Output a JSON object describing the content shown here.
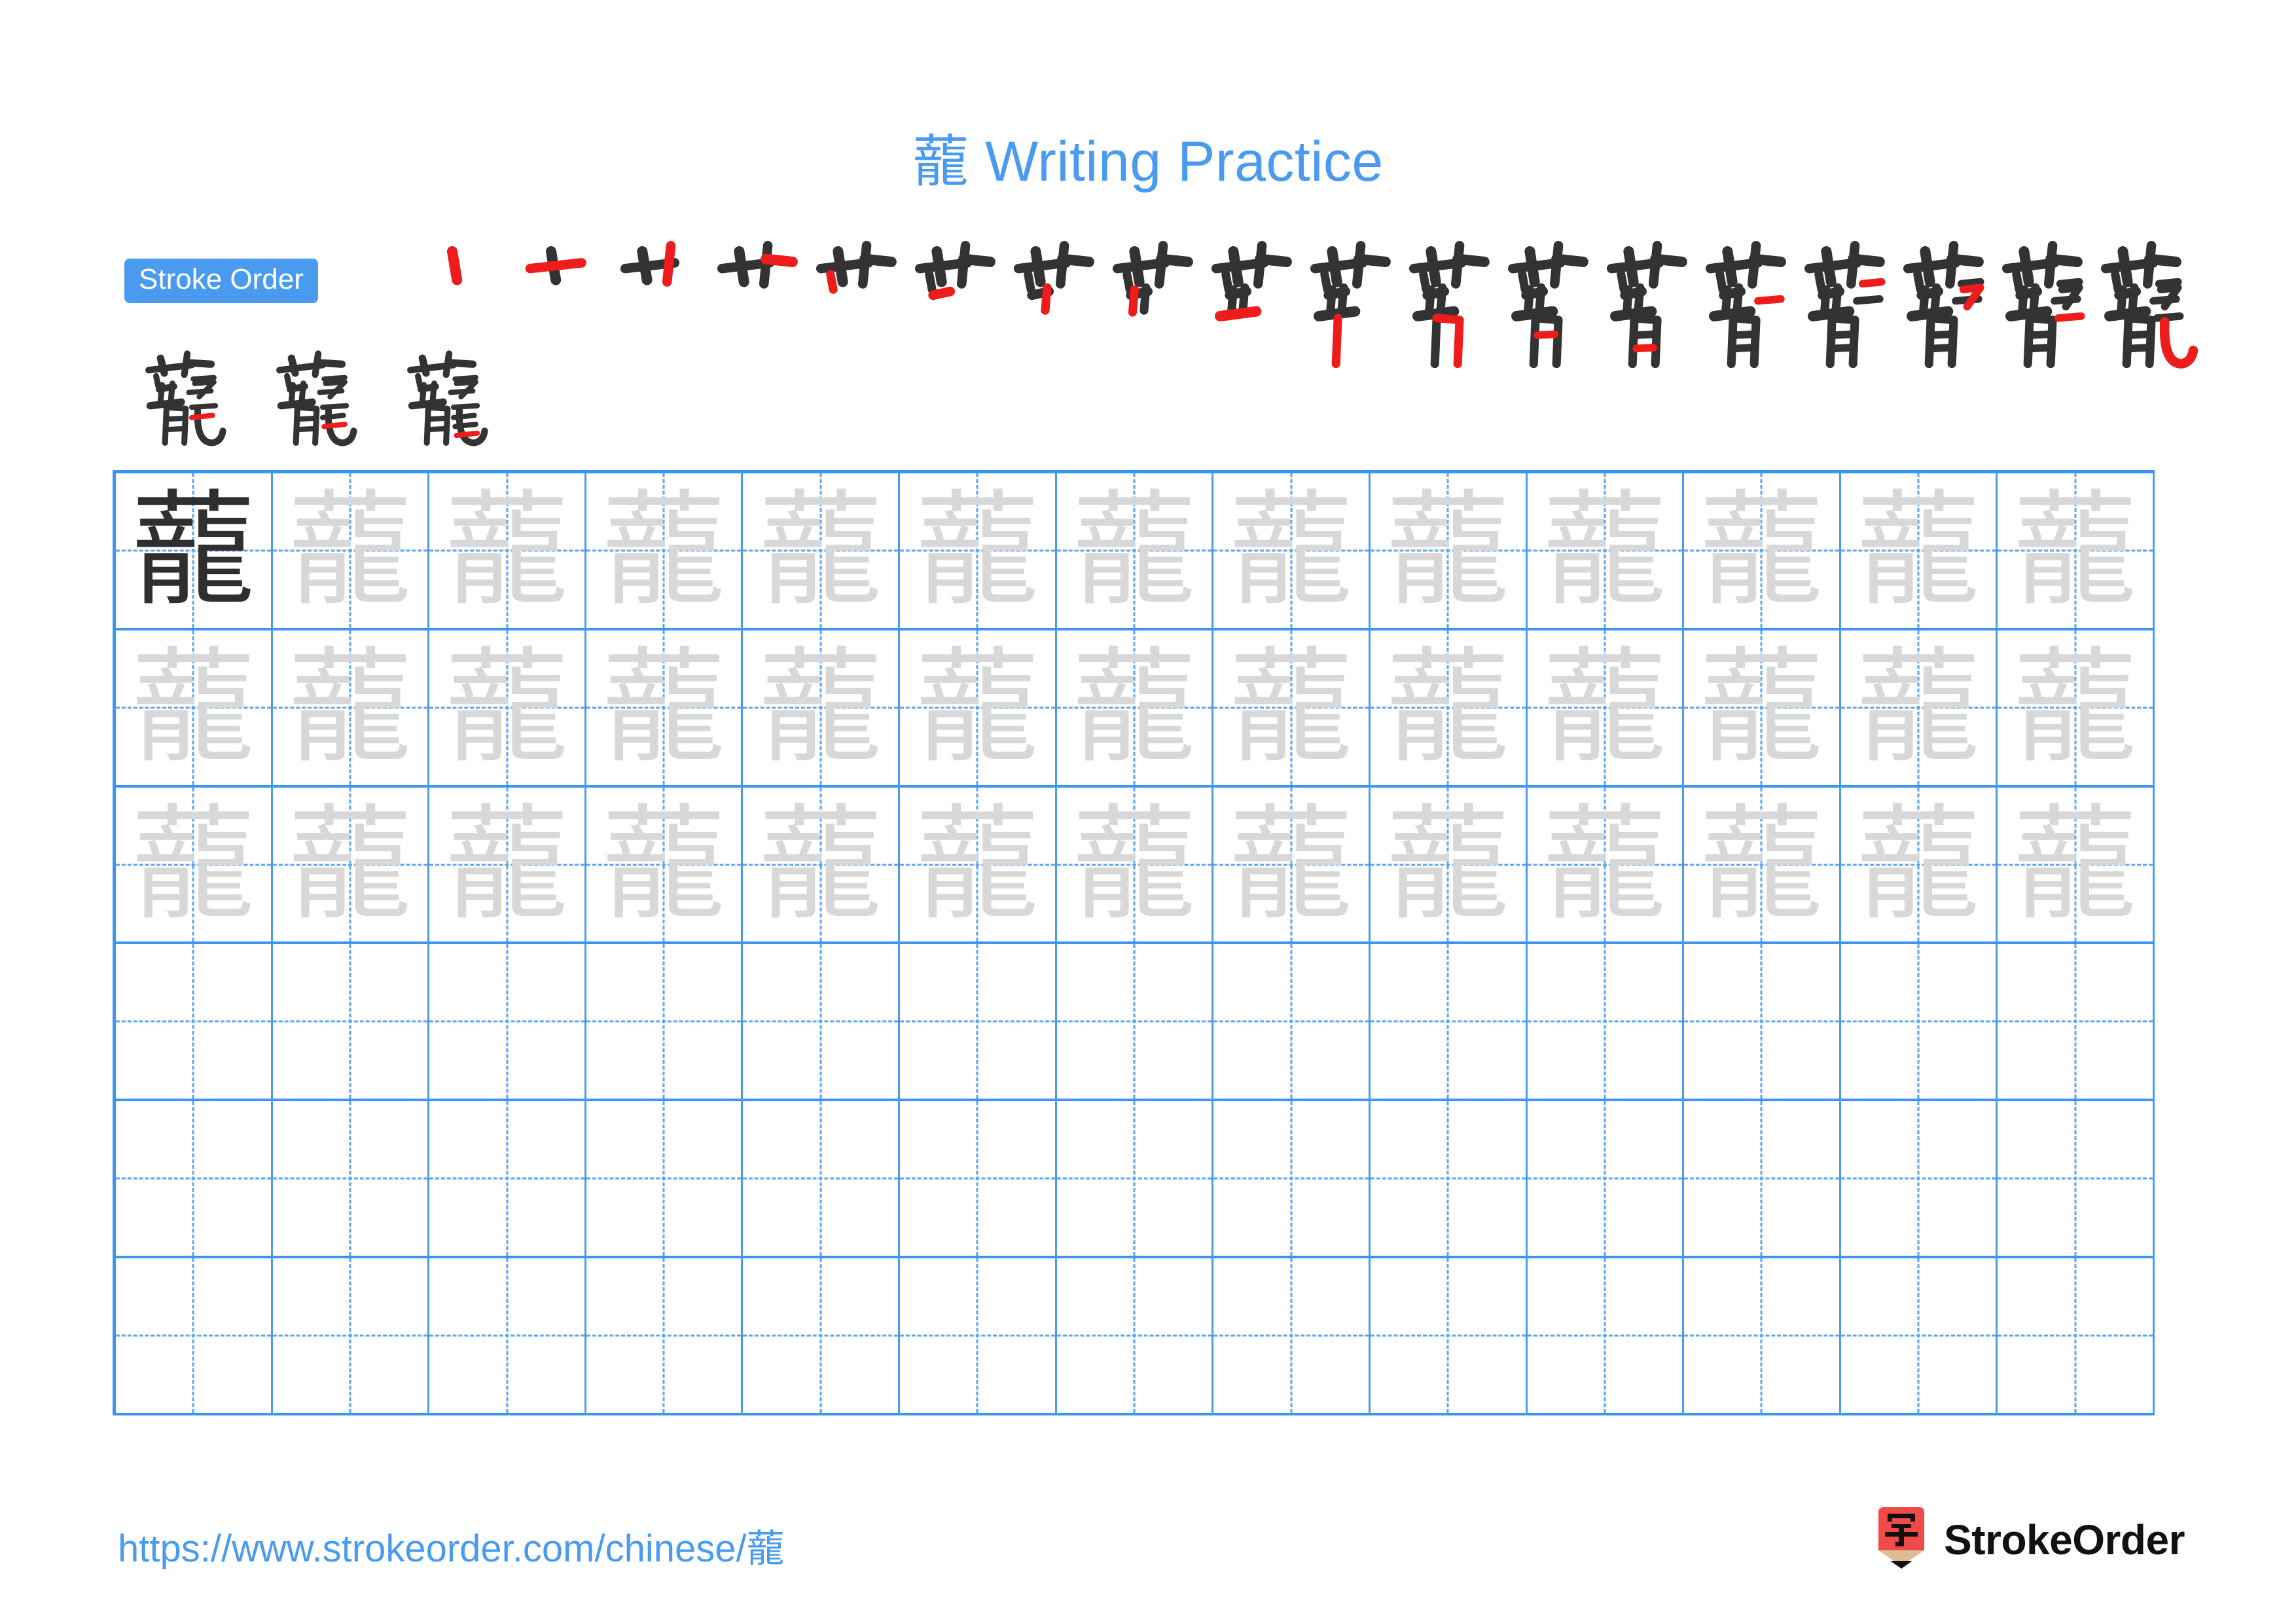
{
  "page": {
    "character": "蘢",
    "title_text": "蘢 Writing Practice",
    "title_color": "#4a9bf0",
    "background": "#ffffff"
  },
  "stroke_order": {
    "badge_label": "Stroke Order",
    "badge_bg": "#4a9bf0",
    "badge_text_color": "#ffffff",
    "total_strokes": 21,
    "new_stroke_color": "#ee1c1c",
    "prior_stroke_color": "#333333",
    "row1_count": 18,
    "row2_count": 3,
    "steps": [
      {
        "index": 1,
        "glyph": "丶",
        "new_stroke": "dot"
      },
      {
        "index": 2,
        "glyph": "一",
        "new_stroke": "horizontal"
      },
      {
        "index": 3,
        "glyph": "屮",
        "new_stroke": "vertical"
      },
      {
        "index": 4,
        "glyph": "艹",
        "new_stroke": "horizontal"
      },
      {
        "index": 5,
        "glyph": "艹",
        "new_stroke": "vertical"
      },
      {
        "index": 6,
        "glyph": "艹",
        "new_stroke": "dot"
      },
      {
        "index": 7,
        "glyph": "艹",
        "new_stroke": "vertical"
      },
      {
        "index": 8,
        "glyph": "艹",
        "new_stroke": "vertical"
      },
      {
        "index": 9,
        "glyph": "竝",
        "new_stroke": "horizontal"
      },
      {
        "index": 10,
        "glyph": "䒑",
        "new_stroke": "vertical"
      },
      {
        "index": 11,
        "glyph": "㔾",
        "new_stroke": "vertical-hook"
      },
      {
        "index": 12,
        "glyph": "肯",
        "new_stroke": "horizontal"
      },
      {
        "index": 13,
        "glyph": "肯",
        "new_stroke": "horizontal"
      },
      {
        "index": 14,
        "glyph": "肯",
        "new_stroke": "horizontal"
      },
      {
        "index": 15,
        "glyph": "肯",
        "new_stroke": "horizontal"
      },
      {
        "index": 16,
        "glyph": "龍",
        "new_stroke": "turning"
      },
      {
        "index": 17,
        "glyph": "龍",
        "new_stroke": "horizontal"
      },
      {
        "index": 18,
        "glyph": "龍",
        "new_stroke": "vertical-bend-hook"
      },
      {
        "index": 19,
        "glyph": "蘢",
        "new_stroke": "horizontal"
      },
      {
        "index": 20,
        "glyph": "蘢",
        "new_stroke": "horizontal"
      },
      {
        "index": 21,
        "glyph": "蘢",
        "new_stroke": "horizontal"
      }
    ]
  },
  "practice_grid": {
    "columns": 13,
    "rows": 6,
    "grid_line_color": "#3c94f2",
    "guide_line_color": "#5aa6f5",
    "dark_char_color": "#2f2f2f",
    "light_char_color": "#d8d8d8",
    "row_fills": [
      {
        "row": 1,
        "first_cell": "dark",
        "rest": "light"
      },
      {
        "row": 2,
        "first_cell": "light",
        "rest": "light"
      },
      {
        "row": 3,
        "first_cell": "light",
        "rest": "light"
      },
      {
        "row": 4,
        "first_cell": "empty",
        "rest": "empty"
      },
      {
        "row": 5,
        "first_cell": "empty",
        "rest": "empty"
      },
      {
        "row": 6,
        "first_cell": "empty",
        "rest": "empty"
      }
    ]
  },
  "footer": {
    "url": "https://www.strokeorder.com/chinese/蘢",
    "url_color": "#4a9bf0",
    "brand_name": "StrokeOrder",
    "logo_char": "字",
    "logo_body_color": "#f04b4b",
    "logo_wood_color": "#debd95",
    "logo_tip_color": "#111111"
  }
}
